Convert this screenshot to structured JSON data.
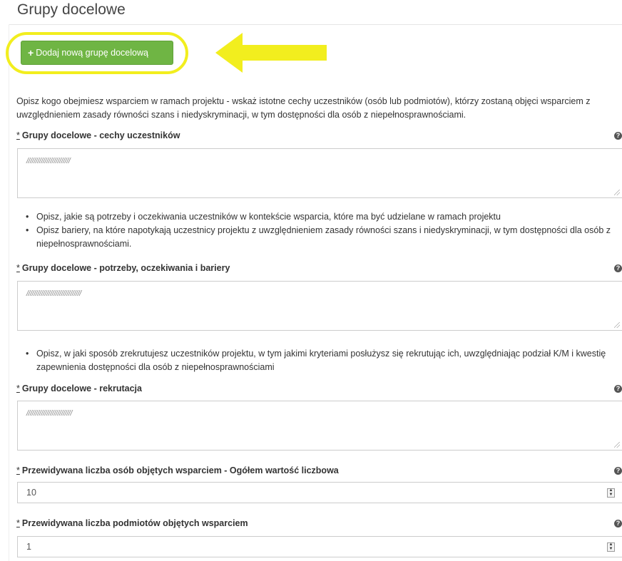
{
  "section": {
    "title": "Grupy docelowe",
    "add_button_label": "Dodaj nową grupę docelową",
    "intro": "Opisz kogo obejmiesz wsparciem w ramach projektu - wskaż istotne cechy uczestników (osób lub podmiotów), którzy zostaną objęci wsparciem z uwzględnieniem zasady równości szans i niedyskryminacji, w tym dostępności dla osób z niepełnosprawnościami."
  },
  "fields": [
    {
      "required": "*",
      "label": "Grupy docelowe - cechy uczestników",
      "value": "////////////////////////"
    },
    {
      "required": "*",
      "label": "Grupy docelowe - potrzeby, oczekiwania i bariery",
      "value": "//////////////////////////////"
    },
    {
      "required": "*",
      "label": "Grupy docelowe - rekrutacja",
      "value": "/////////////////////////"
    },
    {
      "required": "*",
      "label": "Przewidywana liczba osób objętych wsparciem - Ogółem wartość liczbowa",
      "value": "10"
    },
    {
      "required": "*",
      "label": "Przewidywana liczba podmiotów objętych wsparciem",
      "value": "1"
    }
  ],
  "hints": {
    "needs": [
      "Opisz, jakie są potrzeby i oczekiwania uczestników w kontekście wsparcia, które ma być udzielane w ramach projektu",
      "Opisz bariery, na które napotykają uczestnicy projektu z uwzględnieniem zasady równości szans i niedyskryminacji, w tym dostępności dla osób z niepełnosprawnościami."
    ],
    "recruitment": [
      "Opisz, w jaki sposób zrekrutujesz uczestników projektu, w tym jakimi kryteriami posłużysz się rekrutując ich, uwzględniając podział K/M i kwestię zapewnienia dostępności dla osób z niepełnosprawnościami"
    ]
  },
  "colors": {
    "button_bg": "#6fb544",
    "highlight": "#f2ee1e",
    "arrow": "#f2ee1e"
  },
  "icons": {
    "help": "question-circle-icon",
    "add": "plus-icon",
    "spinner": "number-spinner-icon"
  }
}
